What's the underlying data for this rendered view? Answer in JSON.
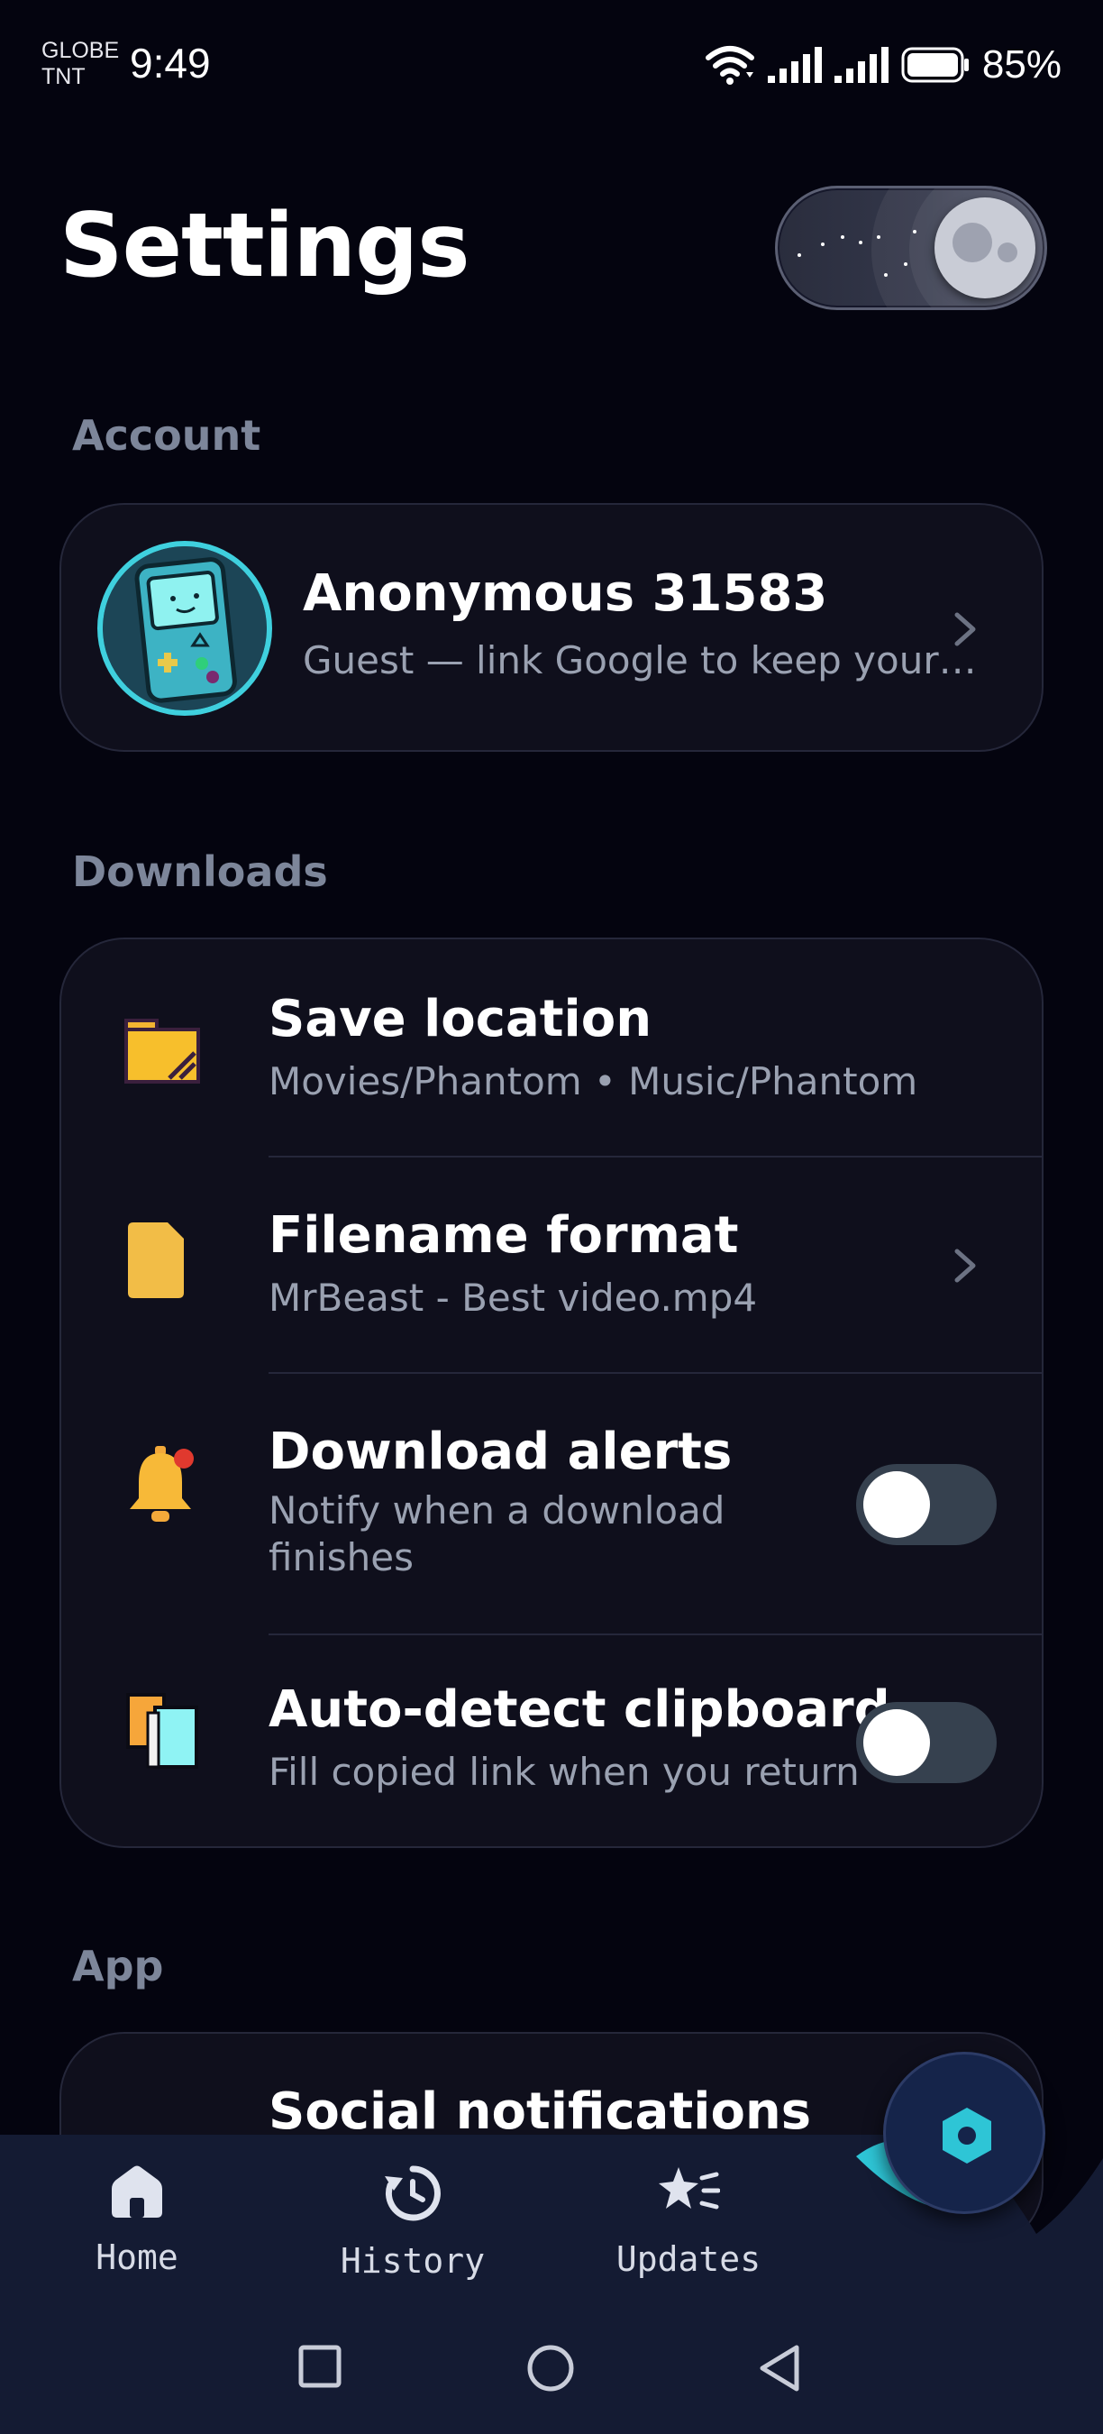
{
  "status_bar": {
    "carrier_line1": "GLOBE",
    "carrier_line2": "TNT",
    "time": "9:49",
    "battery": "85%"
  },
  "header": {
    "title": "Settings"
  },
  "account": {
    "section_label": "Account",
    "name": "Anonymous 31583",
    "subtitle": "Guest — link Google to keep your…"
  },
  "downloads": {
    "section_label": "Downloads",
    "items": [
      {
        "title": "Save location",
        "subtitle": "Movies/Phantom • Music/Phantom"
      },
      {
        "title": "Filename format",
        "subtitle": "MrBeast - Best video.mp4"
      },
      {
        "title": "Download alerts",
        "subtitle_line1": "Notify when a download",
        "subtitle_line2": "finishes",
        "enabled": false
      },
      {
        "title": "Auto-detect clipboard",
        "subtitle": "Fill copied link when you return",
        "enabled": false
      }
    ]
  },
  "app": {
    "section_label": "App",
    "items": [
      {
        "title": "Social notifications"
      }
    ]
  },
  "bottom_nav": {
    "items": [
      {
        "label": "Home"
      },
      {
        "label": "History"
      },
      {
        "label": "Updates"
      }
    ]
  },
  "colors": {
    "background": "#04040f",
    "card": "#0f0f1c",
    "accent": "#2ec5d6",
    "section_label": "#7d869a",
    "nav_bar": "#141b33"
  }
}
